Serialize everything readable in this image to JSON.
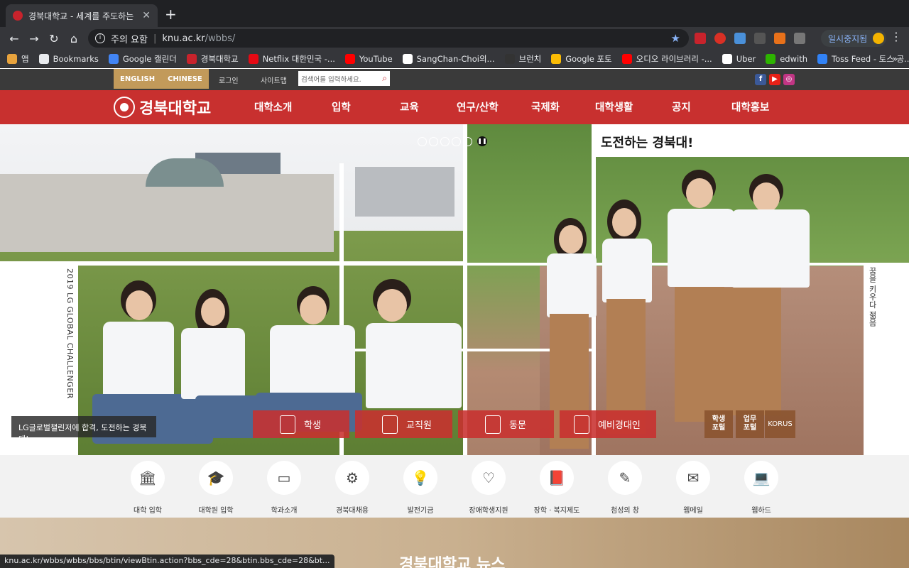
{
  "browser": {
    "tab_title": "경북대학교 - 세계를 주도하는 첨성인",
    "tab_close": "✕",
    "new_tab": "+",
    "security_label": "주의 요함",
    "url_host": "knu.ac.kr",
    "url_path": "/wbbs/",
    "profile_label": "일시중지됨",
    "bookmarks": [
      {
        "label": "앱",
        "icon": "apps-grid-icon",
        "color": "#e8a33d"
      },
      {
        "label": "Bookmarks",
        "icon": "star-icon",
        "color": "#e8eaed"
      },
      {
        "label": "Google 캘린더",
        "icon": "calendar-icon",
        "color": "#4285f4"
      },
      {
        "label": "경북대학교",
        "icon": "knu-icon",
        "color": "#c8232c"
      },
      {
        "label": "Netflix 대한민국 -...",
        "icon": "netflix-icon",
        "color": "#e50914"
      },
      {
        "label": "YouTube",
        "icon": "youtube-icon",
        "color": "#ff0000"
      },
      {
        "label": "SangChan-Choi의...",
        "icon": "google-icon",
        "color": "#ffffff"
      },
      {
        "label": "브런치",
        "icon": "brunch-icon",
        "color": "#333333"
      },
      {
        "label": "Google 포토",
        "icon": "photos-icon",
        "color": "#fbbc05"
      },
      {
        "label": "오디오 라이브러리 -...",
        "icon": "youtube-icon",
        "color": "#ff0000"
      },
      {
        "label": "Uber",
        "icon": "globe-icon",
        "color": "#ffffff"
      },
      {
        "label": "edwith",
        "icon": "edwith-icon",
        "color": "#2db400"
      },
      {
        "label": "Toss Feed - 토스 공...",
        "icon": "toss-icon",
        "color": "#3182f6"
      }
    ],
    "bookmarks_more": "»",
    "status_url": "knu.ac.kr/wbbs/wbbs/bbs/btin/viewBtin.action?bbs_cde=28&btin.bbs_cde=28&bt..."
  },
  "site": {
    "lang_en": "ENGLISH",
    "lang_cn": "CHINESE",
    "login": "로그인",
    "sitemap": "사이트맵",
    "search_placeholder": "검색어를 입력하세요.",
    "logo_text": "경북대학교",
    "menu": [
      "대학소개",
      "입학",
      "교육",
      "연구/산학",
      "국제화",
      "대학생활",
      "공지",
      "대학홍보"
    ],
    "hero": {
      "slogan": "도전하는 경북대!",
      "vertical_left": "2019 LG GLOBAL CHALLENGER",
      "vertical_right": "꿈을 키우다 젊음",
      "caption": "LG글로벌챌린저에 합격, 도전하는 경북대!",
      "quick_buttons": [
        "학생",
        "교직원",
        "동문",
        "예비경대인"
      ],
      "portal_buttons": [
        "학생\n포털",
        "업무\n포털"
      ],
      "korus": "KORUS"
    },
    "quick_links": [
      {
        "label": "대학 입학",
        "icon": "building-icon"
      },
      {
        "label": "대학원 입학",
        "icon": "graduation-cap-icon"
      },
      {
        "label": "학과소개",
        "icon": "browser-icon"
      },
      {
        "label": "경북대채용",
        "icon": "document-gear-icon"
      },
      {
        "label": "발전기금",
        "icon": "lightbulb-icon"
      },
      {
        "label": "장애학생지원",
        "icon": "heart-plus-icon"
      },
      {
        "label": "장학 · 복지제도",
        "icon": "book-icon"
      },
      {
        "label": "첨성의 창",
        "icon": "pencil-icon"
      },
      {
        "label": "웹메일",
        "icon": "mail-icon"
      },
      {
        "label": "웹하드",
        "icon": "laptop-icon"
      }
    ],
    "news_title": "경북대학교 뉴스"
  }
}
